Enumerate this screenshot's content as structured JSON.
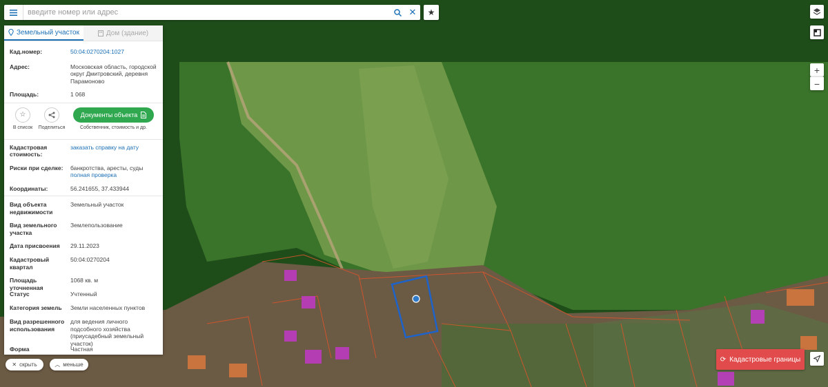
{
  "search": {
    "placeholder": "введите номер или адрес"
  },
  "tabs": {
    "land": "Земельный участок",
    "building": "Дом (здание)"
  },
  "parcel": {
    "cad_label": "Кад.номер:",
    "cad_value": "50:04:0270204:1027",
    "addr_label": "Адрес:",
    "addr_value": "Московская область, городской округ Дмитровский, деревня Парамоново",
    "area_label": "Площадь:",
    "area_value": "1 068"
  },
  "actions": {
    "list": "В список",
    "share": "Поделиться",
    "docs_button": "Документы объекта",
    "docs_sub": "Собственник, стоимость и др."
  },
  "value_info": {
    "cost_label": "Кадастровая стоимость:",
    "cost_link": "заказать справку на дату",
    "risk_label": "Риски при сделке:",
    "risk_value": "банкротства, аресты, суды",
    "risk_link": "полная проверка",
    "coords_label": "Координаты:",
    "coords_value": "56.241655, 37.433944"
  },
  "details": [
    {
      "label": "Вид объекта недвижимости",
      "value": "Земельный участок"
    },
    {
      "label": "Вид земельного участка",
      "value": "Землепользование"
    },
    {
      "label": "Дата присвоения",
      "value": "29.11.2023"
    },
    {
      "label": "Кадастровый квартал",
      "value": "50:04:0270204"
    },
    {
      "label": "Площадь уточненная",
      "value": "1068 кв. м"
    },
    {
      "label": "Статус",
      "value": "Учтенный"
    },
    {
      "label": "Категория земель",
      "value": "Земли населенных пунктов"
    },
    {
      "label": "Вид разрешенного использования",
      "value": "для ведения личного подсобного хозяйства (приусадебный земельный участок)"
    },
    {
      "label": "Форма собственности",
      "value": "Частная"
    }
  ],
  "bottom": {
    "hide": "скрыть",
    "less": "меньше"
  },
  "cad_borders": "Кадастровые границы",
  "map": {
    "forest_color": "#1f4d1a",
    "meadow_color": "#5f8a3f",
    "zone_color": "#2f9a2f",
    "parcel_border": "#d9542c",
    "selected_border": "#1e63c9",
    "building_color": "#c238c8"
  },
  "icons": {
    "menu": "menu-icon",
    "search": "search-icon",
    "clear": "close-icon",
    "favorites": "star-icon",
    "layers": "layers-icon",
    "fullscreen": "fullscreen-icon",
    "zoom_in": "plus-icon",
    "zoom_out": "minus-icon",
    "land_tab": "pin-icon",
    "building_tab": "building-icon",
    "list": "star-outline-icon",
    "share": "share-icon",
    "docs": "document-icon",
    "refresh": "refresh-icon",
    "locate": "navigation-icon"
  }
}
